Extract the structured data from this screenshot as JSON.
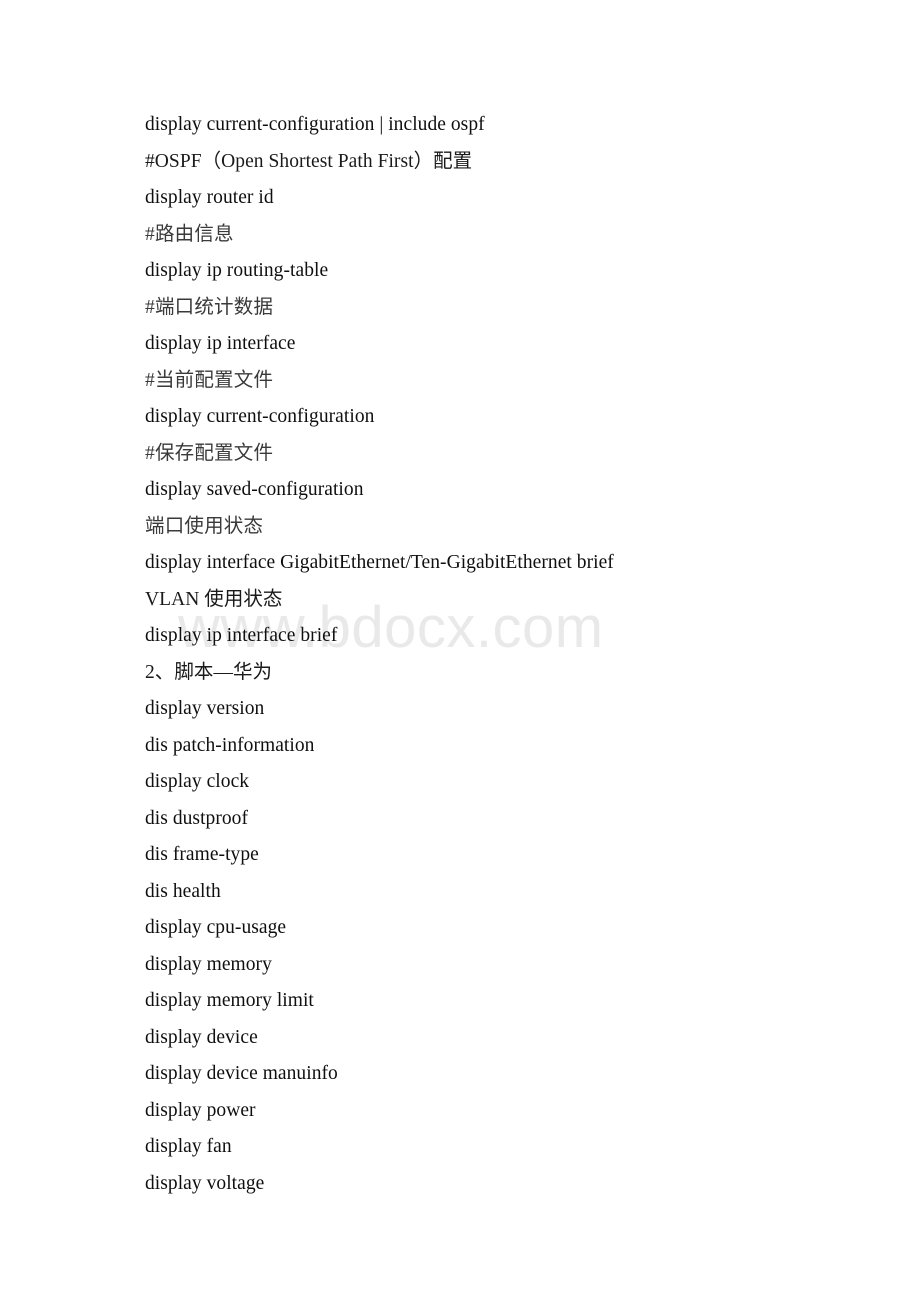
{
  "document": {
    "background_color": "#ffffff",
    "text_color": "#100f0f",
    "annotation_color": "#3a3a3a",
    "watermark_color": "#e9e9e9",
    "watermark": "www.bdocx.com",
    "lines": [
      {
        "text": "display current-configuration | include ospf",
        "kind": "command"
      },
      {
        "text": "#OSPF（Open Shortest Path First）配置",
        "kind": "mixed"
      },
      {
        "text": "display router id",
        "kind": "command"
      },
      {
        "text": "#路由信息",
        "kind": "cjk"
      },
      {
        "text": "display ip routing-table",
        "kind": "command"
      },
      {
        "text": "#端口统计数据",
        "kind": "cjk"
      },
      {
        "text": "display ip interface",
        "kind": "command"
      },
      {
        "text": "#当前配置文件",
        "kind": "cjk"
      },
      {
        "text": "display current-configuration",
        "kind": "command"
      },
      {
        "text": "#保存配置文件",
        "kind": "cjk"
      },
      {
        "text": "display saved-configuration",
        "kind": "command"
      },
      {
        "text": "端口使用状态",
        "kind": "cjk"
      },
      {
        "text": "display interface GigabitEthernet/Ten-GigabitEthernet brief",
        "kind": "command"
      },
      {
        "text": "VLAN 使用状态",
        "kind": "mixed"
      },
      {
        "text": "display ip interface brief",
        "kind": "command"
      },
      {
        "text": "2、脚本—华为",
        "kind": "mixed"
      },
      {
        "text": "display version",
        "kind": "command"
      },
      {
        "text": "dis patch-information",
        "kind": "command"
      },
      {
        "text": "display clock",
        "kind": "command"
      },
      {
        "text": "dis dustproof",
        "kind": "command"
      },
      {
        "text": "dis frame-type",
        "kind": "command"
      },
      {
        "text": "dis health",
        "kind": "command"
      },
      {
        "text": "display cpu-usage",
        "kind": "command"
      },
      {
        "text": "display memory",
        "kind": "command"
      },
      {
        "text": "display memory limit",
        "kind": "command"
      },
      {
        "text": "display device",
        "kind": "command"
      },
      {
        "text": "display device manuinfo",
        "kind": "command"
      },
      {
        "text": "display power",
        "kind": "command"
      },
      {
        "text": "display fan",
        "kind": "command"
      },
      {
        "text": "display voltage",
        "kind": "command"
      }
    ]
  }
}
